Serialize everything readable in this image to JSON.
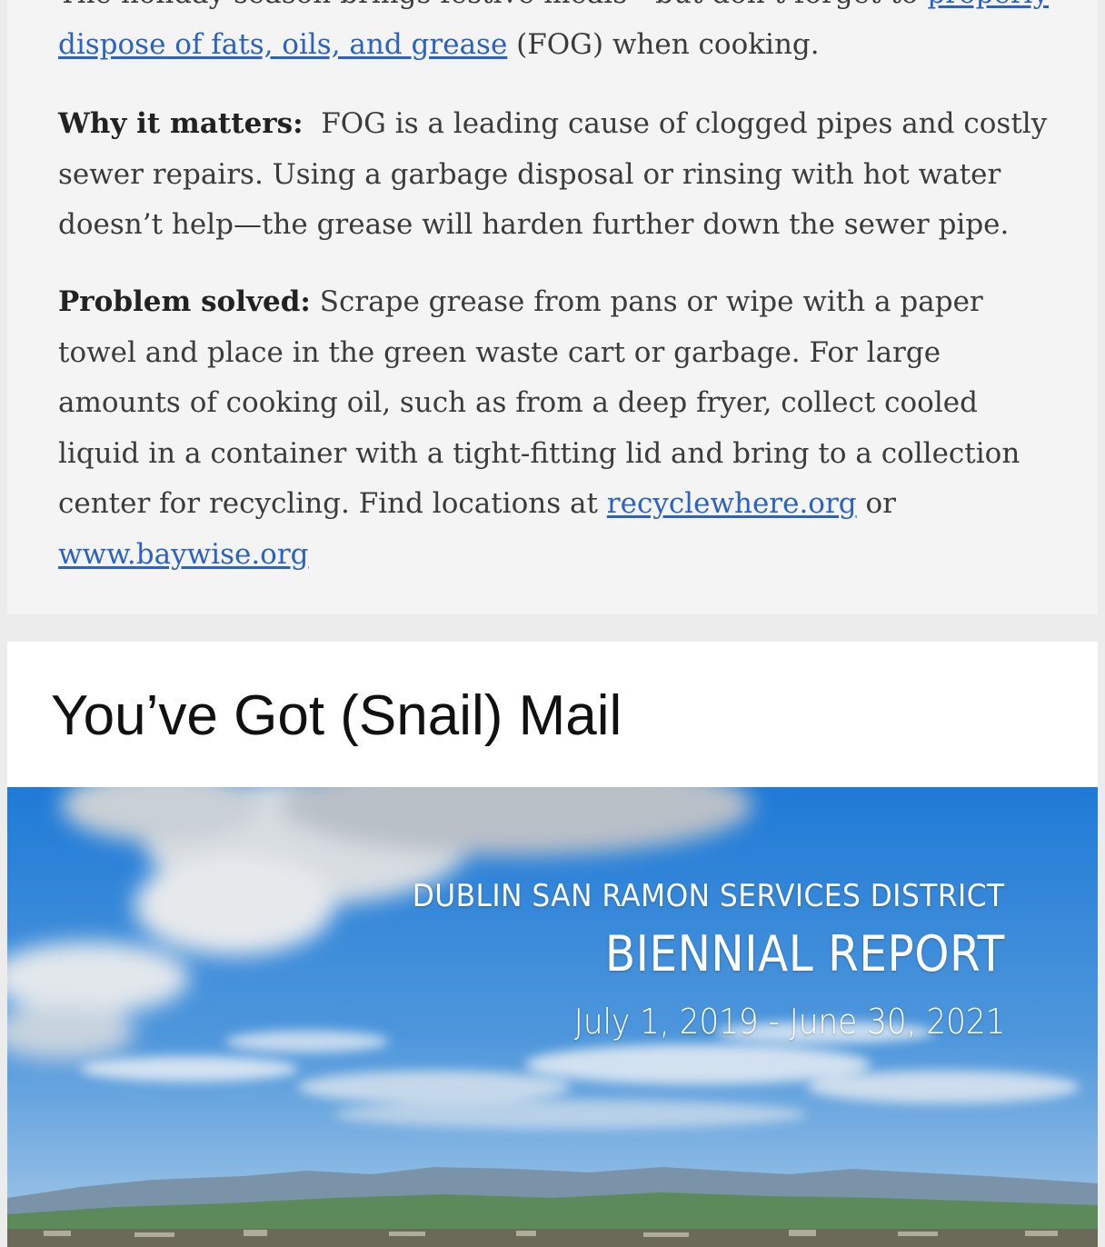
{
  "article1": {
    "intro_before_link": "The holiday season brings festive meals—but don’t forget to ",
    "intro_link": "properly dispose of fats, oils, and grease",
    "intro_after_link": " (FOG) when cooking.",
    "why_label": "Why it matters:",
    "why_text": "  FOG is a leading cause of clogged pipes and costly sewer repairs. Using a garbage disposal or rinsing with hot water doesn’t help—the grease will harden further down the sewer pipe.",
    "solved_label": "Problem solved:",
    "solved_text": " Scrape grease from pans or wipe with a paper towel and place in the green waste cart or garbage. For large amounts of cooking oil, such as from a deep fryer, collect cooled liquid in a container with a tight-fitting lid and bring to a collection center for recycling. Find locations at ",
    "link1": "recyclewhere.org",
    "or_text": " or ",
    "link2": "www.baywise.org"
  },
  "article2": {
    "title": "You’ve Got (Snail) Mail",
    "hero": {
      "line1": "DUBLIN SAN RAMON SERVICES DISTRICT",
      "line2": "BIENNIAL REPORT",
      "line3": "July 1, 2019 - June 30, 2021"
    }
  },
  "colors": {
    "link": "#2a62c7",
    "sky_top": "#1f7ad6",
    "sky_bottom": "#8fbde6",
    "hills": "#5d8a5a"
  }
}
